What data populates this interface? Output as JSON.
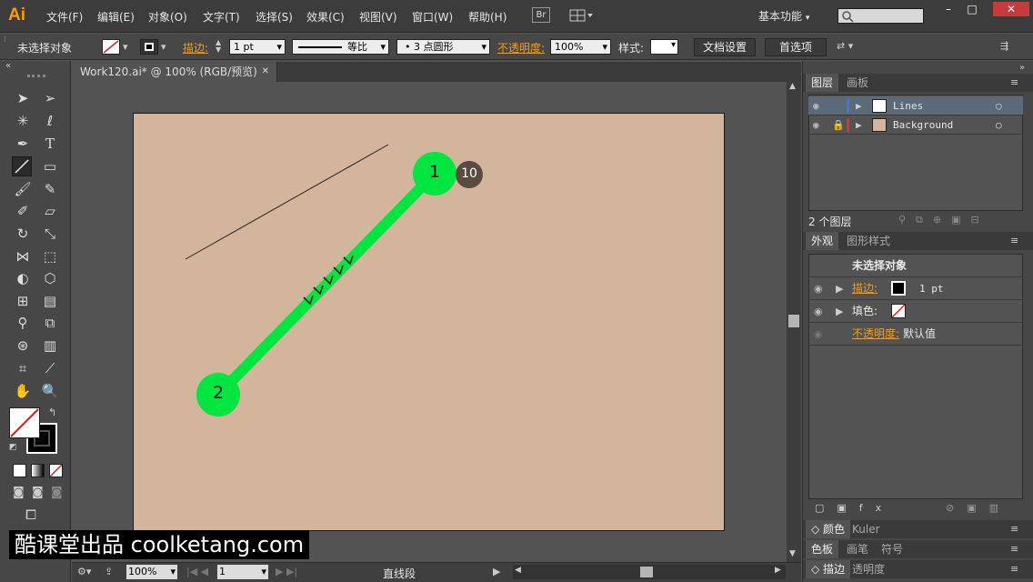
{
  "app": {
    "logo": "Ai"
  },
  "menu": [
    {
      "label": "文件(F)"
    },
    {
      "label": "编辑(E)"
    },
    {
      "label": "对象(O)"
    },
    {
      "label": "文字(T)"
    },
    {
      "label": "选择(S)"
    },
    {
      "label": "效果(C)"
    },
    {
      "label": "视图(V)"
    },
    {
      "label": "窗口(W)"
    },
    {
      "label": "帮助(H)"
    }
  ],
  "bridge_label": "Br",
  "workspace_label": "基本功能",
  "window_controls": {
    "minimize": "–",
    "restore": "□",
    "close": "✕"
  },
  "control_bar": {
    "selection_status": "未选择对象",
    "stroke_label": "描边:",
    "stroke_weight": "1 pt",
    "stroke_profile": "等比",
    "brush": "3 点圆形",
    "opacity_label": "不透明度:",
    "opacity_value": "100%",
    "style_label": "样式:",
    "doc_setup_button": "文档设置",
    "preferences_button": "首选项"
  },
  "document_tab": {
    "title": "Work120.ai* @ 100% (RGB/预览)",
    "close": "✕"
  },
  "annotations": {
    "point1": "1",
    "point2": "2",
    "step": "10"
  },
  "layers_panel": {
    "tabs": [
      "图层",
      "画板"
    ],
    "layers": [
      {
        "name": "Lines"
      },
      {
        "name": "Background"
      }
    ],
    "count_label": "2 个图层"
  },
  "appearance_panel": {
    "tabs": [
      "外观",
      "图形样式"
    ],
    "title": "未选择对象",
    "stroke_label": "描边:",
    "stroke_value": "1 pt",
    "fill_label": "填色:",
    "opacity_label": "不透明度:",
    "opacity_value": "默认值"
  },
  "collapsed_panels": [
    {
      "tabs": [
        "颜色",
        "Kuler"
      ]
    },
    {
      "tabs": [
        "色板",
        "画笔",
        "符号"
      ]
    },
    {
      "tabs": [
        "描边",
        "透明度"
      ]
    }
  ],
  "status_bar": {
    "zoom": "100%",
    "page": "1",
    "tool_name": "直线段"
  },
  "watermark": {
    "text": "酷课堂出品 coolketang.com"
  },
  "colors": {
    "artboard": "#d3b59b",
    "highlight_green": "#00e640",
    "badge": "#5a4a40",
    "accent_orange": "#ff9a00"
  }
}
